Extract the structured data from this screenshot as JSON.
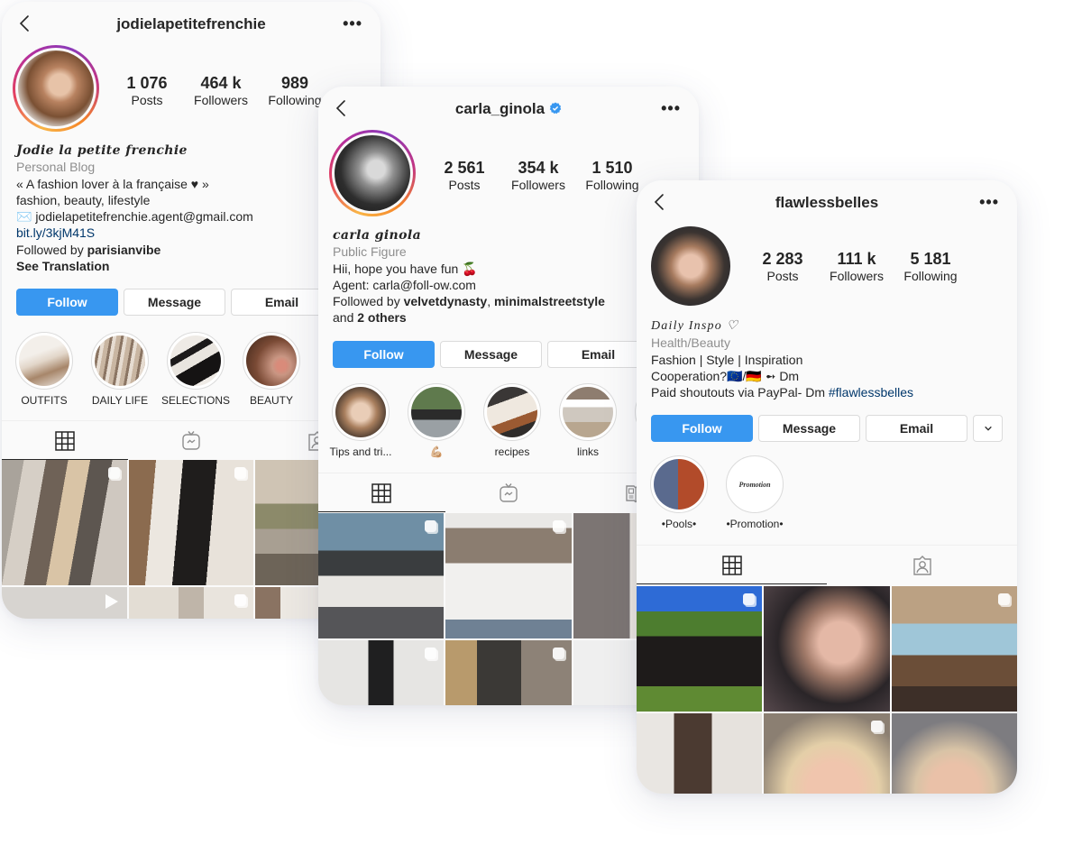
{
  "profiles": [
    {
      "username": "jodielapetitefrenchie",
      "verified": false,
      "stats": [
        {
          "value": "1 076",
          "label": "Posts"
        },
        {
          "value": "464 k",
          "label": "Followers"
        },
        {
          "value": "989",
          "label": "Following"
        }
      ],
      "bio": {
        "display_name": "Jodie la petite frenchie",
        "category": "Personal Blog",
        "lines": [
          "« A fashion lover à la française ♥ »",
          "fashion, beauty, lifestyle",
          "✉️ jodielapetitefrenchie.agent@gmail.com"
        ],
        "link": "bit.ly/3kjM41S",
        "followed_by_prefix": "Followed by ",
        "followed_by": "parisianvibe",
        "see_translation": "See Translation"
      },
      "buttons": {
        "follow": "Follow",
        "message": "Message",
        "email": "Email"
      },
      "highlights": [
        {
          "label": "OUTFITS"
        },
        {
          "label": "DAILY LIFE"
        },
        {
          "label": "SELECTIONS"
        },
        {
          "label": "BEAUTY"
        },
        {
          "label": ""
        }
      ],
      "tabs": [
        "grid-icon",
        "igtv-icon",
        "tagged-icon"
      ]
    },
    {
      "username": "carla_ginola",
      "verified": true,
      "stats": [
        {
          "value": "2 561",
          "label": "Posts"
        },
        {
          "value": "354 k",
          "label": "Followers"
        },
        {
          "value": "1 510",
          "label": "Following"
        }
      ],
      "bio": {
        "display_name": "carla ginola",
        "category": "Public Figure",
        "line1": "Hii, hope you have fun 🍒",
        "line2": "Agent: carla@foll-ow.com",
        "followed_by_prefix": "Followed by ",
        "followed_by_1": "velvetdynasty",
        "followed_by_sep": ", ",
        "followed_by_2": "minimalstreetstyle",
        "and_prefix": "and ",
        "others": "2 others"
      },
      "buttons": {
        "follow": "Follow",
        "message": "Message",
        "email": "Email"
      },
      "highlights": [
        {
          "label": "Tips and tri..."
        },
        {
          "label": "💪🏼"
        },
        {
          "label": "recipes"
        },
        {
          "label": "links"
        },
        {
          "label": ""
        }
      ],
      "tabs": [
        "grid-icon",
        "igtv-icon",
        "guides-icon"
      ]
    },
    {
      "username": "flawlessbelles",
      "verified": false,
      "stats": [
        {
          "value": "2 283",
          "label": "Posts"
        },
        {
          "value": "111 k",
          "label": "Followers"
        },
        {
          "value": "5 181",
          "label": "Following"
        }
      ],
      "bio": {
        "display_name": "Daily Inspo ♡",
        "category": "Health/Beauty",
        "line1": "Fashion | Style | Inspiration",
        "line2": "Cooperation?🇪🇺/🇩🇪 ➻ Dm",
        "line3_prefix": "Paid shoutouts via PayPal- Dm ",
        "hashtag": "#flawlessbelles"
      },
      "buttons": {
        "follow": "Follow",
        "message": "Message",
        "email": "Email",
        "more": "⌄"
      },
      "highlights": [
        {
          "label": "•Pools•"
        },
        {
          "label": "•Promotion•",
          "cover_text": "Promotion"
        }
      ],
      "tabs": [
        "grid-icon",
        "tagged-icon"
      ]
    }
  ],
  "colors": {
    "follow_button": "#3897f0",
    "link": "#00376b",
    "category": "#8e8e8e",
    "verified_badge": "#3897f0"
  }
}
